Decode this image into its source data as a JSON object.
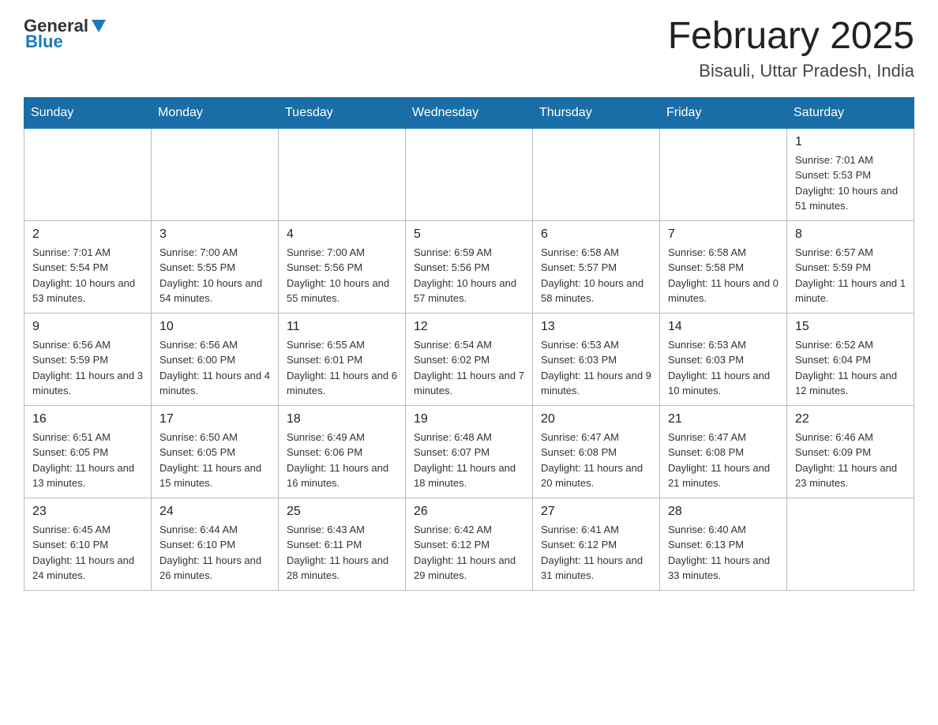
{
  "header": {
    "logo_general": "General",
    "logo_blue": "Blue",
    "title": "February 2025",
    "subtitle": "Bisauli, Uttar Pradesh, India"
  },
  "days_of_week": [
    "Sunday",
    "Monday",
    "Tuesday",
    "Wednesday",
    "Thursday",
    "Friday",
    "Saturday"
  ],
  "weeks": [
    [
      null,
      null,
      null,
      null,
      null,
      null,
      {
        "day": "1",
        "sunrise": "Sunrise: 7:01 AM",
        "sunset": "Sunset: 5:53 PM",
        "daylight": "Daylight: 10 hours and 51 minutes."
      }
    ],
    [
      {
        "day": "2",
        "sunrise": "Sunrise: 7:01 AM",
        "sunset": "Sunset: 5:54 PM",
        "daylight": "Daylight: 10 hours and 53 minutes."
      },
      {
        "day": "3",
        "sunrise": "Sunrise: 7:00 AM",
        "sunset": "Sunset: 5:55 PM",
        "daylight": "Daylight: 10 hours and 54 minutes."
      },
      {
        "day": "4",
        "sunrise": "Sunrise: 7:00 AM",
        "sunset": "Sunset: 5:56 PM",
        "daylight": "Daylight: 10 hours and 55 minutes."
      },
      {
        "day": "5",
        "sunrise": "Sunrise: 6:59 AM",
        "sunset": "Sunset: 5:56 PM",
        "daylight": "Daylight: 10 hours and 57 minutes."
      },
      {
        "day": "6",
        "sunrise": "Sunrise: 6:58 AM",
        "sunset": "Sunset: 5:57 PM",
        "daylight": "Daylight: 10 hours and 58 minutes."
      },
      {
        "day": "7",
        "sunrise": "Sunrise: 6:58 AM",
        "sunset": "Sunset: 5:58 PM",
        "daylight": "Daylight: 11 hours and 0 minutes."
      },
      {
        "day": "8",
        "sunrise": "Sunrise: 6:57 AM",
        "sunset": "Sunset: 5:59 PM",
        "daylight": "Daylight: 11 hours and 1 minute."
      }
    ],
    [
      {
        "day": "9",
        "sunrise": "Sunrise: 6:56 AM",
        "sunset": "Sunset: 5:59 PM",
        "daylight": "Daylight: 11 hours and 3 minutes."
      },
      {
        "day": "10",
        "sunrise": "Sunrise: 6:56 AM",
        "sunset": "Sunset: 6:00 PM",
        "daylight": "Daylight: 11 hours and 4 minutes."
      },
      {
        "day": "11",
        "sunrise": "Sunrise: 6:55 AM",
        "sunset": "Sunset: 6:01 PM",
        "daylight": "Daylight: 11 hours and 6 minutes."
      },
      {
        "day": "12",
        "sunrise": "Sunrise: 6:54 AM",
        "sunset": "Sunset: 6:02 PM",
        "daylight": "Daylight: 11 hours and 7 minutes."
      },
      {
        "day": "13",
        "sunrise": "Sunrise: 6:53 AM",
        "sunset": "Sunset: 6:03 PM",
        "daylight": "Daylight: 11 hours and 9 minutes."
      },
      {
        "day": "14",
        "sunrise": "Sunrise: 6:53 AM",
        "sunset": "Sunset: 6:03 PM",
        "daylight": "Daylight: 11 hours and 10 minutes."
      },
      {
        "day": "15",
        "sunrise": "Sunrise: 6:52 AM",
        "sunset": "Sunset: 6:04 PM",
        "daylight": "Daylight: 11 hours and 12 minutes."
      }
    ],
    [
      {
        "day": "16",
        "sunrise": "Sunrise: 6:51 AM",
        "sunset": "Sunset: 6:05 PM",
        "daylight": "Daylight: 11 hours and 13 minutes."
      },
      {
        "day": "17",
        "sunrise": "Sunrise: 6:50 AM",
        "sunset": "Sunset: 6:05 PM",
        "daylight": "Daylight: 11 hours and 15 minutes."
      },
      {
        "day": "18",
        "sunrise": "Sunrise: 6:49 AM",
        "sunset": "Sunset: 6:06 PM",
        "daylight": "Daylight: 11 hours and 16 minutes."
      },
      {
        "day": "19",
        "sunrise": "Sunrise: 6:48 AM",
        "sunset": "Sunset: 6:07 PM",
        "daylight": "Daylight: 11 hours and 18 minutes."
      },
      {
        "day": "20",
        "sunrise": "Sunrise: 6:47 AM",
        "sunset": "Sunset: 6:08 PM",
        "daylight": "Daylight: 11 hours and 20 minutes."
      },
      {
        "day": "21",
        "sunrise": "Sunrise: 6:47 AM",
        "sunset": "Sunset: 6:08 PM",
        "daylight": "Daylight: 11 hours and 21 minutes."
      },
      {
        "day": "22",
        "sunrise": "Sunrise: 6:46 AM",
        "sunset": "Sunset: 6:09 PM",
        "daylight": "Daylight: 11 hours and 23 minutes."
      }
    ],
    [
      {
        "day": "23",
        "sunrise": "Sunrise: 6:45 AM",
        "sunset": "Sunset: 6:10 PM",
        "daylight": "Daylight: 11 hours and 24 minutes."
      },
      {
        "day": "24",
        "sunrise": "Sunrise: 6:44 AM",
        "sunset": "Sunset: 6:10 PM",
        "daylight": "Daylight: 11 hours and 26 minutes."
      },
      {
        "day": "25",
        "sunrise": "Sunrise: 6:43 AM",
        "sunset": "Sunset: 6:11 PM",
        "daylight": "Daylight: 11 hours and 28 minutes."
      },
      {
        "day": "26",
        "sunrise": "Sunrise: 6:42 AM",
        "sunset": "Sunset: 6:12 PM",
        "daylight": "Daylight: 11 hours and 29 minutes."
      },
      {
        "day": "27",
        "sunrise": "Sunrise: 6:41 AM",
        "sunset": "Sunset: 6:12 PM",
        "daylight": "Daylight: 11 hours and 31 minutes."
      },
      {
        "day": "28",
        "sunrise": "Sunrise: 6:40 AM",
        "sunset": "Sunset: 6:13 PM",
        "daylight": "Daylight: 11 hours and 33 minutes."
      },
      null
    ]
  ]
}
